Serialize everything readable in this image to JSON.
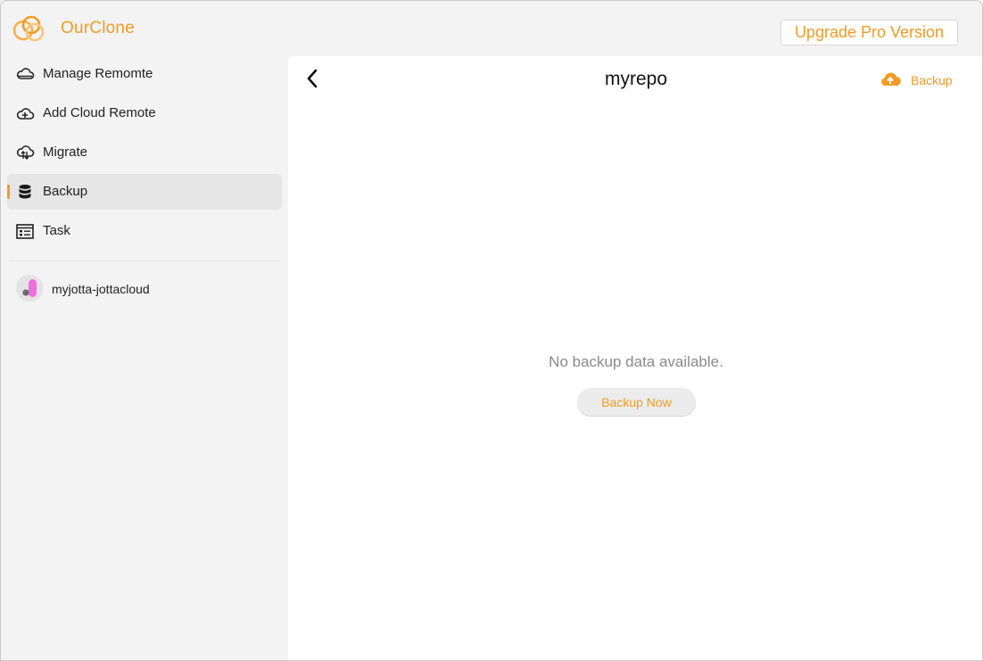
{
  "app": {
    "name": "OurClone",
    "brand_color": "#f29b22",
    "logo_icon": "rings-logo-icon"
  },
  "header": {
    "upgrade_label": "Upgrade Pro Version"
  },
  "sidebar": {
    "items": [
      {
        "label": "Manage Remomte",
        "icon": "cloud-manage-icon",
        "active": false
      },
      {
        "label": "Add Cloud Remote",
        "icon": "cloud-add-icon",
        "active": false
      },
      {
        "label": "Migrate",
        "icon": "cloud-migrate-icon",
        "active": false
      },
      {
        "label": "Backup",
        "icon": "database-icon",
        "active": true
      },
      {
        "label": "Task",
        "icon": "task-list-icon",
        "active": false
      }
    ],
    "remotes": [
      {
        "label": "myjotta-jottacloud",
        "icon": "jottacloud-avatar-icon"
      }
    ]
  },
  "main": {
    "back_icon": "chevron-left-icon",
    "title": "myrepo",
    "backup_action_label": "Backup",
    "backup_action_icon": "cloud-upload-icon",
    "empty_message": "No backup data available.",
    "backup_now_label": "Backup Now"
  }
}
